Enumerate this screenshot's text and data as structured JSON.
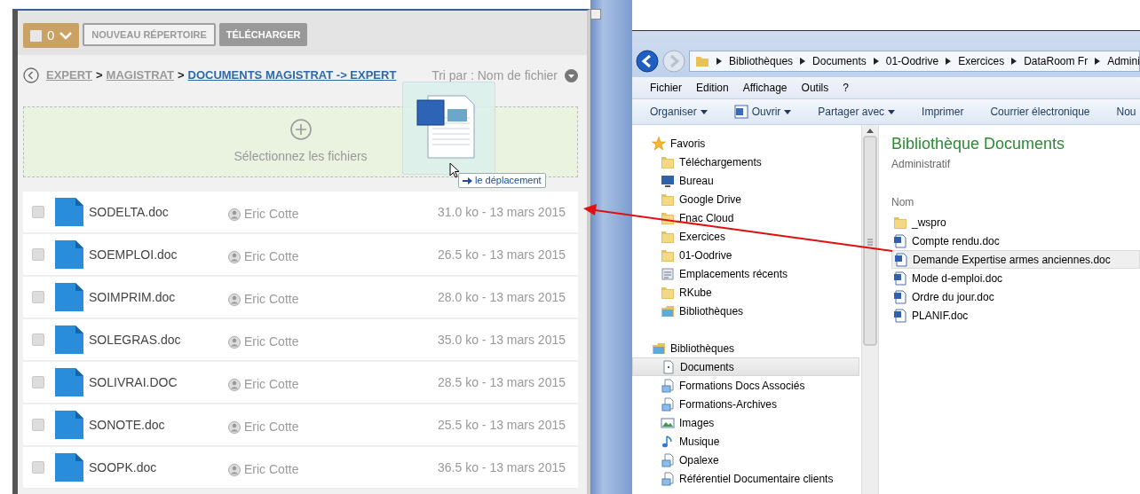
{
  "web_app": {
    "selection_count": "0",
    "buttons": [
      "NOUVEAU RÉPERTOIRE",
      "TÉLÉCHARGER"
    ],
    "breadcrumb": [
      {
        "label": "EXPERT",
        "current": false
      },
      {
        "label": "MAGISTRAT",
        "current": false
      },
      {
        "label": "DOCUMENTS MAGISTRAT -> EXPERT",
        "current": true
      }
    ],
    "breadcrumb_separator": ">",
    "sort": {
      "label": "Tri par : Nom de fichier"
    },
    "dropzone": {
      "label": "Sélectionnez les fichiers"
    },
    "files": [
      {
        "name": "SODELTA.doc",
        "owner": "Eric Cotte",
        "info": "31.0 ko - 13 mars 2015",
        "checked": false
      },
      {
        "name": "SOEMPLOI.doc",
        "owner": "Eric Cotte",
        "info": "26.5 ko - 13 mars 2015",
        "checked": false
      },
      {
        "name": "SOIMPRIM.doc",
        "owner": "Eric Cotte",
        "info": "28.0 ko - 13 mars 2015",
        "checked": false
      },
      {
        "name": "SOLEGRAS.doc",
        "owner": "Eric Cotte",
        "info": "35.0 ko - 13 mars 2015",
        "checked": false
      },
      {
        "name": "SOLIVRAI.DOC",
        "owner": "Eric Cotte",
        "info": "28.5 ko - 13 mars 2015",
        "checked": false
      },
      {
        "name": "SONOTE.doc",
        "owner": "Eric Cotte",
        "info": "25.5 ko - 13 mars 2015",
        "checked": false
      },
      {
        "name": "SOOPK.doc",
        "owner": "Eric Cotte",
        "info": "36.5 ko - 13 mars 2015",
        "checked": false
      }
    ]
  },
  "drag": {
    "tooltip": "le déplacement"
  },
  "explorer": {
    "address": [
      "Bibliothèques",
      "Documents",
      "01-Oodrive",
      "Exercices",
      "DataRoom Fr",
      "Admini"
    ],
    "menu": [
      "Fichier",
      "Edition",
      "Affichage",
      "Outils",
      "?"
    ],
    "commands": [
      {
        "label": "Organiser",
        "dropdown": true,
        "kind": "text"
      },
      {
        "label": "Ouvrir",
        "dropdown": true,
        "kind": "word"
      },
      {
        "label": "Partager avec",
        "dropdown": true,
        "kind": "text"
      },
      {
        "label": "Imprimer",
        "dropdown": false,
        "kind": "text"
      },
      {
        "label": "Courrier électronique",
        "dropdown": false,
        "kind": "text"
      },
      {
        "label": "Nou",
        "dropdown": false,
        "kind": "text"
      }
    ],
    "nav": [
      {
        "label": "Favoris",
        "kind": "star",
        "selected": false,
        "children": [
          {
            "label": "Téléchargements",
            "kind": "folder",
            "selected": false
          },
          {
            "label": "Bureau",
            "kind": "desktop",
            "selected": false
          },
          {
            "label": "Google Drive",
            "kind": "folder",
            "selected": false
          },
          {
            "label": "Fnac Cloud",
            "kind": "folder",
            "selected": false
          },
          {
            "label": "Exercices",
            "kind": "folder",
            "selected": false
          },
          {
            "label": "01-Oodrive",
            "kind": "folder",
            "selected": false
          },
          {
            "label": "Emplacements récents",
            "kind": "recent",
            "selected": false
          },
          {
            "label": "RKube",
            "kind": "folder",
            "selected": false
          },
          {
            "label": "Bibliothèques",
            "kind": "library",
            "selected": false
          }
        ]
      },
      {
        "label": "Bibliothèques",
        "kind": "library",
        "selected": false,
        "children": [
          {
            "label": "Documents",
            "kind": "document",
            "selected": true
          },
          {
            "label": "Formations Docs Associés",
            "kind": "doclib",
            "selected": false
          },
          {
            "label": "Formations-Archives",
            "kind": "doclib",
            "selected": false
          },
          {
            "label": "Images",
            "kind": "images",
            "selected": false
          },
          {
            "label": "Musique",
            "kind": "music",
            "selected": false
          },
          {
            "label": "Opalexe",
            "kind": "doclib",
            "selected": false
          },
          {
            "label": "Référentiel Documentaire clients",
            "kind": "doclib",
            "selected": false
          }
        ]
      }
    ],
    "title": "Bibliothèque Documents",
    "subtitle": "Administratif",
    "column": "Nom",
    "items": [
      {
        "name": "_wspro",
        "kind": "folder",
        "selected": false
      },
      {
        "name": "Compte rendu.doc",
        "kind": "doc",
        "selected": false
      },
      {
        "name": "Demande Expertise armes anciennes.doc",
        "kind": "doc",
        "selected": true
      },
      {
        "name": "Mode d-emploi.doc",
        "kind": "doc",
        "selected": false
      },
      {
        "name": "Ordre du jour.doc",
        "kind": "doc",
        "selected": false
      },
      {
        "name": "PLANIF.doc",
        "kind": "doc",
        "selected": false
      }
    ]
  }
}
